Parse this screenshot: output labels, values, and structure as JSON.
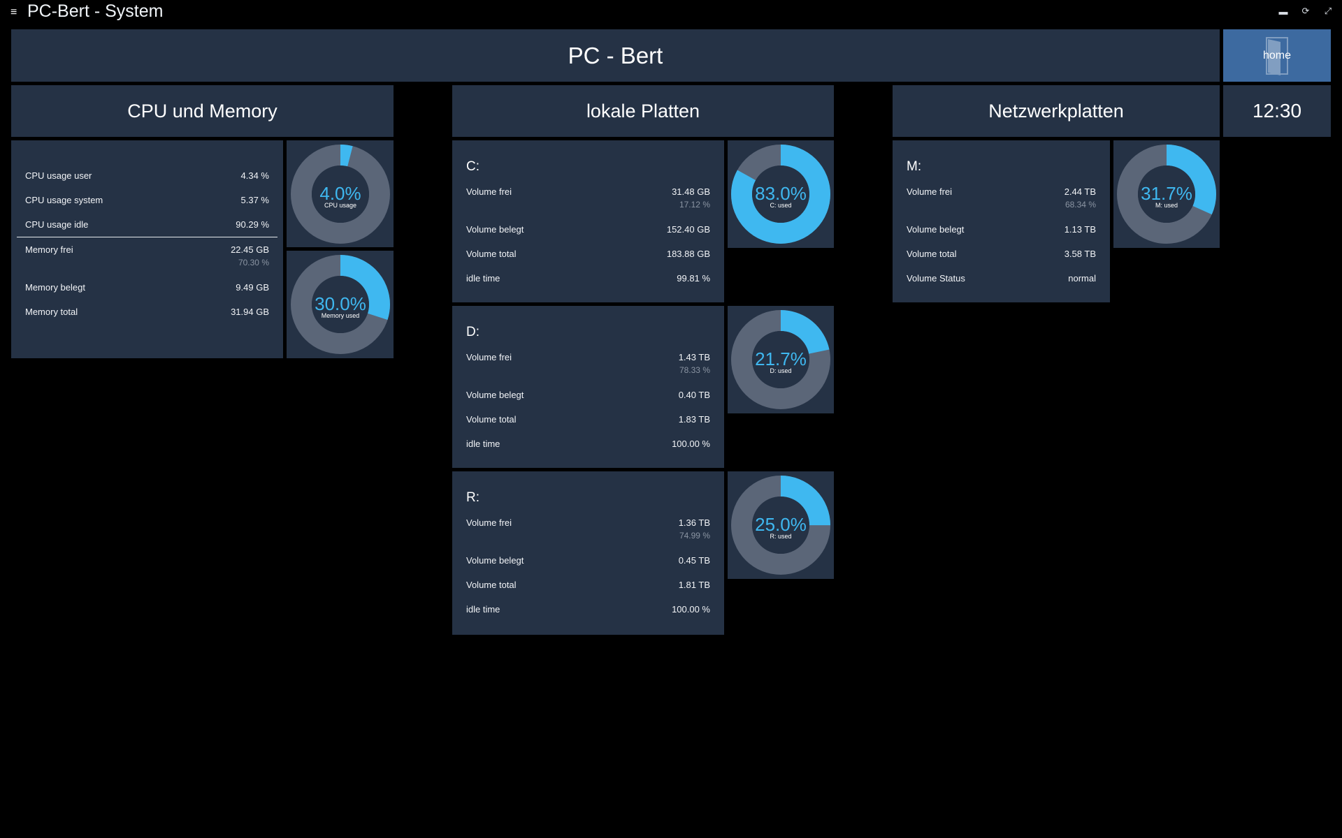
{
  "topbar": {
    "title": "PC-Bert - System",
    "menu_icon": "≡",
    "icons": [
      "chat-icon",
      "refresh-icon",
      "fullscreen-icon"
    ]
  },
  "header": {
    "title": "PC - Bert",
    "home_label": "home",
    "clock": "12:30"
  },
  "colors": {
    "accent": "#3fb8f0",
    "ring": "#5b6678",
    "tile": "#253245",
    "home": "#3d6aa0"
  },
  "sections": {
    "cpu": "CPU und Memory",
    "local": "lokale Platten",
    "network": "Netzwerkplatten"
  },
  "cpu": {
    "rows": [
      {
        "label": "CPU usage user",
        "value": "4.34 %"
      },
      {
        "label": "CPU usage system",
        "value": "5.37 %"
      },
      {
        "label": "CPU usage idle",
        "value": "90.29 %"
      }
    ],
    "memory": [
      {
        "label": "Memory frei",
        "value": "22.45 GB",
        "sub": "70.30 %"
      },
      {
        "label": "Memory belegt",
        "value": "9.49 GB"
      },
      {
        "label": "Memory total",
        "value": "31.94 GB"
      }
    ]
  },
  "gauges": {
    "cpu": {
      "percent": 4.0,
      "text": "4.0%",
      "label": "CPU usage"
    },
    "mem": {
      "percent": 30.0,
      "text": "30.0%",
      "label": "Memory used"
    },
    "c": {
      "percent": 83.0,
      "text": "83.0%",
      "label": "C: used"
    },
    "d": {
      "percent": 21.7,
      "text": "21.7%",
      "label": "D: used"
    },
    "r": {
      "percent": 25.0,
      "text": "25.0%",
      "label": "R: used"
    },
    "m": {
      "percent": 31.7,
      "text": "31.7%",
      "label": "M: used"
    }
  },
  "drives": {
    "c": {
      "name": "C:",
      "rows": [
        {
          "label": "Volume frei",
          "value": "31.48 GB",
          "sub": "17.12 %"
        },
        {
          "label": "Volume belegt",
          "value": "152.40 GB"
        },
        {
          "label": "Volume total",
          "value": "183.88 GB"
        },
        {
          "label": "idle time",
          "value": "99.81 %"
        }
      ]
    },
    "d": {
      "name": "D:",
      "rows": [
        {
          "label": "Volume frei",
          "value": "1.43 TB",
          "sub": "78.33 %"
        },
        {
          "label": "Volume belegt",
          "value": "0.40 TB"
        },
        {
          "label": "Volume total",
          "value": "1.83 TB"
        },
        {
          "label": "idle time",
          "value": "100.00 %"
        }
      ]
    },
    "r": {
      "name": "R:",
      "rows": [
        {
          "label": "Volume frei",
          "value": "1.36 TB",
          "sub": "74.99 %"
        },
        {
          "label": "Volume belegt",
          "value": "0.45 TB"
        },
        {
          "label": "Volume total",
          "value": "1.81 TB"
        },
        {
          "label": "idle time",
          "value": "100.00 %"
        }
      ]
    },
    "m": {
      "name": "M:",
      "rows": [
        {
          "label": "Volume frei",
          "value": "2.44 TB",
          "sub": "68.34 %"
        },
        {
          "label": "Volume belegt",
          "value": "1.13 TB"
        },
        {
          "label": "Volume total",
          "value": "3.58 TB"
        },
        {
          "label": "Volume Status",
          "value": "normal"
        }
      ]
    }
  }
}
